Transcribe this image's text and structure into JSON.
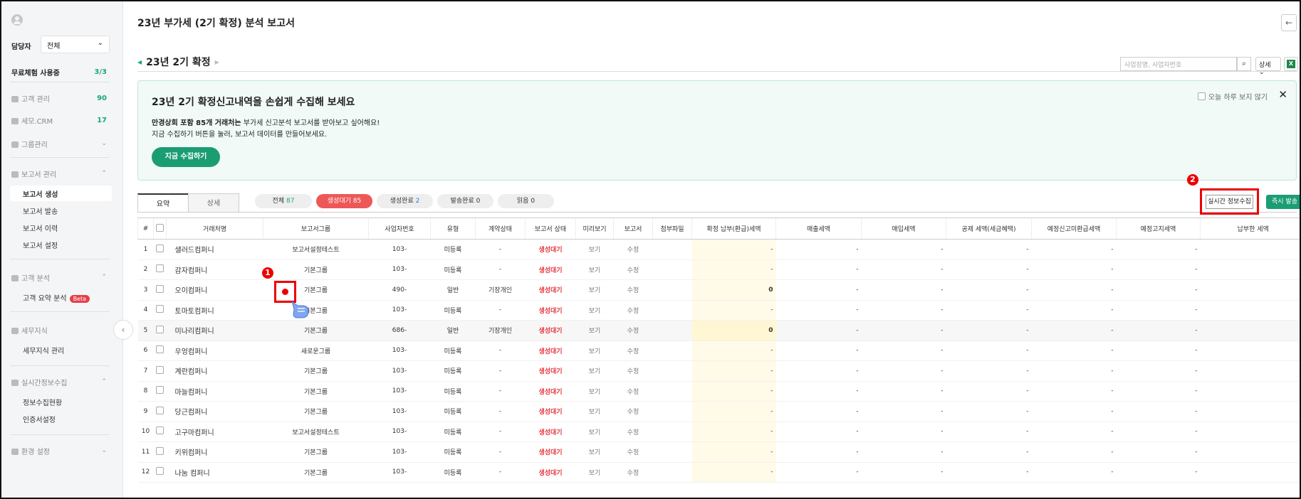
{
  "sidebar": {
    "manager_label": "담당자",
    "manager_value": "전체",
    "trial_label": "무료체험 사용중",
    "trial_count": "3/3",
    "customer_mgmt": {
      "label": "고객 관리",
      "count": "90"
    },
    "semo_crm": {
      "label": "세모.CRM",
      "count": "17"
    },
    "group_mgmt": {
      "label": "그룹관리"
    },
    "report_mgmt": {
      "label": "보고서 관리",
      "items": [
        "보고서 생성",
        "보고서 발송",
        "보고서 이력",
        "보고서 설정"
      ]
    },
    "customer_analysis": {
      "label": "고객 분석",
      "items": [
        "고객 요약 분석"
      ],
      "beta": "Beta"
    },
    "tax_knowledge": {
      "label": "세무지식",
      "items": [
        "세무지식 관리"
      ]
    },
    "realtime_info": {
      "label": "실시간정보수집",
      "items": [
        "정보수집현황",
        "인증서설정"
      ]
    },
    "env_settings": {
      "label": "환경 설정"
    }
  },
  "header": {
    "title": "23년 부가세 (2기 확정) 분석 보고서",
    "period": "23년 2기 확정",
    "search_placeholder": "사업장명, 사업자번호",
    "detail_button": "상세"
  },
  "banner": {
    "title": "23년 2기 확정신고내역을 손쉽게 수집해 보세요",
    "line1_bold": "만경상회 포함 85개 거래처는",
    "line1_rest": " 부가세 신고분석 보고서를 받아보고 싶어해요!",
    "line2": "지금 수집하기 버튼을 눌러, 보고서 데이터를 만들어보세요.",
    "button": "지금 수집하기",
    "hide_today": "오늘 하루 보지 않기",
    "close": "✕"
  },
  "tabs": {
    "summary": "요약",
    "detail": "상세"
  },
  "filters": [
    {
      "label": "전체",
      "count": "87"
    },
    {
      "label": "생성대기",
      "count": "85"
    },
    {
      "label": "생성완료",
      "count": "2"
    },
    {
      "label": "발송완료",
      "count": "0"
    },
    {
      "label": "읽음",
      "count": "0"
    }
  ],
  "actions": {
    "realtime": "실시간 정보수집",
    "instant": "즉시 발송"
  },
  "annotations": {
    "one": "1",
    "two": "2"
  },
  "table": {
    "columns": [
      "#",
      "",
      "거래처명",
      "보고서그룹",
      "사업자번호",
      "유형",
      "계약상태",
      "보고서 상태",
      "미리보기",
      "보고서",
      "첨부파일",
      "확정 납부(환급)세액",
      "매출세액",
      "매입세액",
      "공제 세액(세금혜택)",
      "예정신고미환급세액",
      "예정고지세액",
      "납부한 세액"
    ],
    "rows": [
      {
        "no": "1",
        "name": "샐러드컴퍼니",
        "group": "보고서설정테스트",
        "biz": "103-",
        "type": "미등록",
        "contract": "-",
        "status": "생성대기",
        "preview": "보기",
        "report": "수정",
        "final": "-",
        "sales": "-",
        "purchase": "-",
        "deduct": "-",
        "unrefund": "-",
        "notice": "-"
      },
      {
        "no": "2",
        "name": "감자컴퍼니",
        "group": "기본그룹",
        "biz": "103-",
        "type": "미등록",
        "contract": "-",
        "status": "생성대기",
        "preview": "보기",
        "report": "수정",
        "final": "-",
        "sales": "-",
        "purchase": "-",
        "deduct": "-",
        "unrefund": "-",
        "notice": "-"
      },
      {
        "no": "3",
        "name": "오이컴퍼니",
        "group": "기본그룹",
        "biz": "490-",
        "type": "일반",
        "contract": "기장개인",
        "status": "생성대기",
        "preview": "보기",
        "report": "수정",
        "final": "0",
        "sales": "-",
        "purchase": "-",
        "deduct": "-",
        "unrefund": "-",
        "notice": "-"
      },
      {
        "no": "4",
        "name": "토마토컴퍼니",
        "group": "기본그룹",
        "biz": "103-",
        "type": "미등록",
        "contract": "-",
        "status": "생성대기",
        "preview": "보기",
        "report": "수정",
        "final": "-",
        "sales": "-",
        "purchase": "-",
        "deduct": "-",
        "unrefund": "-",
        "notice": "-"
      },
      {
        "no": "5",
        "name": "미나리컴퍼니",
        "group": "기본그룹",
        "biz": "686-",
        "type": "일반",
        "contract": "기장개인",
        "status": "생성대기",
        "preview": "보기",
        "report": "수정",
        "final": "0",
        "sales": "-",
        "purchase": "-",
        "deduct": "-",
        "unrefund": "-",
        "notice": "-"
      },
      {
        "no": "6",
        "name": "우엉컴퍼니",
        "group": "새로운그룹",
        "biz": "103-",
        "type": "미등록",
        "contract": "-",
        "status": "생성대기",
        "preview": "보기",
        "report": "수정",
        "final": "-",
        "sales": "-",
        "purchase": "-",
        "deduct": "-",
        "unrefund": "-",
        "notice": "-"
      },
      {
        "no": "7",
        "name": "계란컴퍼니",
        "group": "기본그룹",
        "biz": "103-",
        "type": "미등록",
        "contract": "-",
        "status": "생성대기",
        "preview": "보기",
        "report": "수정",
        "final": "-",
        "sales": "-",
        "purchase": "-",
        "deduct": "-",
        "unrefund": "-",
        "notice": "-"
      },
      {
        "no": "8",
        "name": "마늘컴퍼니",
        "group": "기본그룹",
        "biz": "103-",
        "type": "미등록",
        "contract": "-",
        "status": "생성대기",
        "preview": "보기",
        "report": "수정",
        "final": "-",
        "sales": "-",
        "purchase": "-",
        "deduct": "-",
        "unrefund": "-",
        "notice": "-"
      },
      {
        "no": "9",
        "name": "당근컴퍼니",
        "group": "기본그룹",
        "biz": "103-",
        "type": "미등록",
        "contract": "-",
        "status": "생성대기",
        "preview": "보기",
        "report": "수정",
        "final": "-",
        "sales": "-",
        "purchase": "-",
        "deduct": "-",
        "unrefund": "-",
        "notice": "-"
      },
      {
        "no": "10",
        "name": "고구마컴퍼니",
        "group": "보고서설정테스트",
        "biz": "103-",
        "type": "미등록",
        "contract": "-",
        "status": "생성대기",
        "preview": "보기",
        "report": "수정",
        "final": "-",
        "sales": "-",
        "purchase": "-",
        "deduct": "-",
        "unrefund": "-",
        "notice": "-"
      },
      {
        "no": "11",
        "name": "키위컴퍼니",
        "group": "기본그룹",
        "biz": "103-",
        "type": "미등록",
        "contract": "-",
        "status": "생성대기",
        "preview": "보기",
        "report": "수정",
        "final": "-",
        "sales": "-",
        "purchase": "-",
        "deduct": "-",
        "unrefund": "-",
        "notice": "-"
      },
      {
        "no": "12",
        "name": "나눔 컴퍼니",
        "group": "기본그룹",
        "biz": "103-",
        "type": "미등록",
        "contract": "-",
        "status": "생성대기",
        "preview": "보기",
        "report": "수정",
        "final": "-",
        "sales": "-",
        "purchase": "-",
        "deduct": "-",
        "unrefund": "-",
        "notice": "-"
      }
    ]
  }
}
